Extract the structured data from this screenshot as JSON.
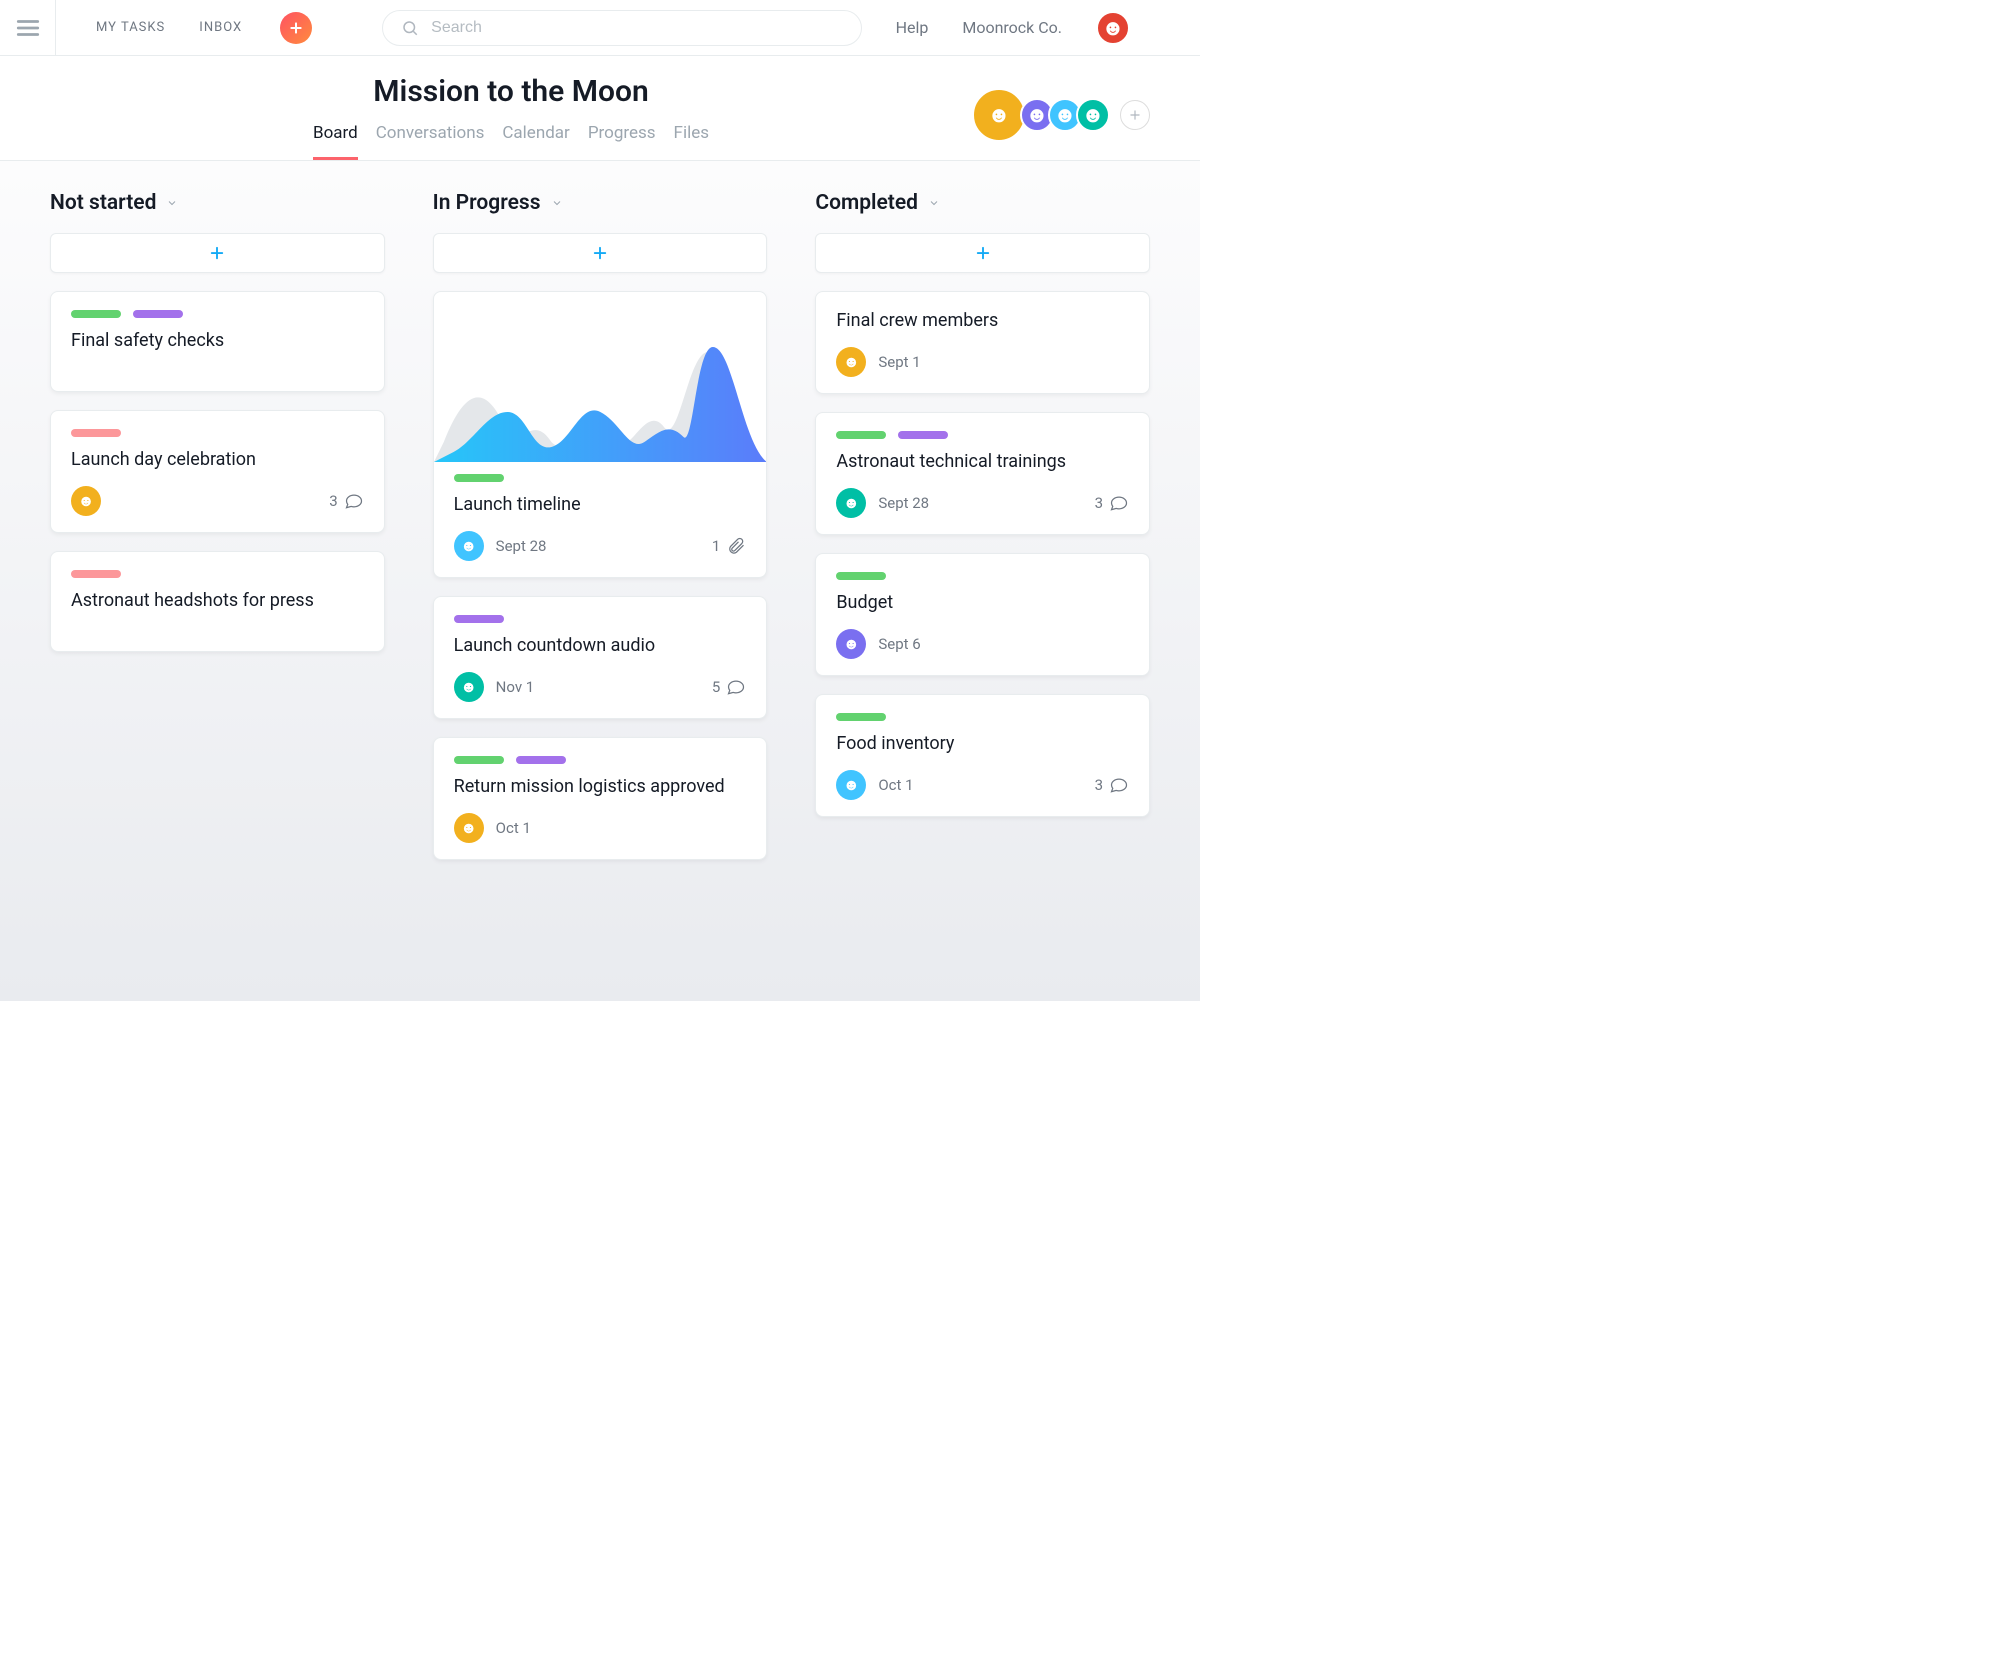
{
  "nav": {
    "my_tasks": "MY TASKS",
    "inbox": "INBOX",
    "help": "Help",
    "org": "Moonrock Co."
  },
  "search": {
    "placeholder": "Search"
  },
  "project": {
    "title": "Mission to the Moon",
    "tabs": [
      "Board",
      "Conversations",
      "Calendar",
      "Progress",
      "Files"
    ],
    "active_tab": 0
  },
  "members": [
    {
      "color": "#f2b01e"
    },
    {
      "color": "#7a6ff0"
    },
    {
      "color": "#40c4ff"
    },
    {
      "color": "#00bfa5"
    }
  ],
  "user_avatar_color": "#e44232",
  "columns": [
    {
      "name": "Not started",
      "cards": [
        {
          "tags": [
            "green",
            "purple"
          ],
          "title": "Final safety checks"
        },
        {
          "tags": [
            "pink"
          ],
          "title": "Launch day celebration",
          "assignee_color": "#f2b01e",
          "comments": 3
        },
        {
          "tags": [
            "pink"
          ],
          "title": "Astronaut headshots for press"
        }
      ]
    },
    {
      "name": "In Progress",
      "cards": [
        {
          "has_chart": true,
          "tags": [
            "green"
          ],
          "title": "Launch timeline",
          "assignee_color": "#40c4ff",
          "due": "Sept 28",
          "attachments": 1
        },
        {
          "tags": [
            "purple"
          ],
          "title": "Launch countdown audio",
          "assignee_color": "#00bfa5",
          "due": "Nov 1",
          "comments": 5
        },
        {
          "tags": [
            "green",
            "purple"
          ],
          "title": "Return mission logistics approved",
          "assignee_color": "#f2b01e",
          "due": "Oct 1"
        }
      ]
    },
    {
      "name": "Completed",
      "cards": [
        {
          "title": "Final crew members",
          "assignee_color": "#f2b01e",
          "due": "Sept 1"
        },
        {
          "tags": [
            "green",
            "purple"
          ],
          "title": "Astronaut technical trainings",
          "assignee_color": "#00bfa5",
          "due": "Sept 28",
          "comments": 3
        },
        {
          "tags": [
            "green"
          ],
          "title": "Budget",
          "assignee_color": "#7a6ff0",
          "due": "Sept 6"
        },
        {
          "tags": [
            "green"
          ],
          "title": "Food inventory",
          "assignee_color": "#40c4ff",
          "due": "Oct 1",
          "comments": 3
        }
      ]
    }
  ]
}
